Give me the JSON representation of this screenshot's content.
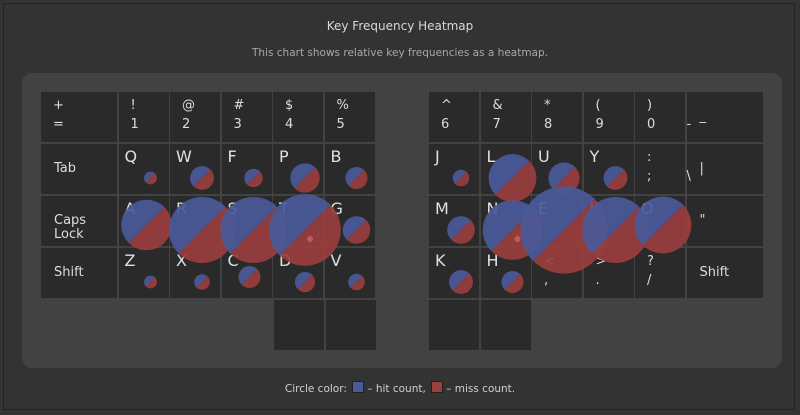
{
  "title": "Key Frequency Heatmap",
  "subtitle": "This chart shows relative key frequencies as a heatmap.",
  "legend": {
    "prefix": "Circle color:",
    "hit_label": "– hit count,",
    "miss_label": "– miss count.",
    "hit_color": "#4a5a9a",
    "miss_color": "#9a3e3e"
  },
  "left_rows": [
    [
      {
        "top": "+",
        "bot": "="
      },
      {
        "top": "!",
        "bot": "1"
      },
      {
        "top": "@",
        "bot": "2"
      },
      {
        "top": "#",
        "bot": "3"
      },
      {
        "top": "$",
        "bot": "4"
      },
      {
        "top": "%",
        "bot": "5"
      }
    ],
    [
      {
        "top": "Tab",
        "wide": true
      },
      {
        "top": "Q",
        "letter": true
      },
      {
        "top": "W",
        "letter": true
      },
      {
        "top": "F",
        "letter": true
      },
      {
        "top": "P",
        "letter": true
      },
      {
        "top": "B",
        "letter": true
      }
    ],
    [
      {
        "top": "Caps Lock",
        "wide": true
      },
      {
        "top": "A",
        "letter": true
      },
      {
        "top": "R",
        "letter": true
      },
      {
        "top": "S",
        "letter": true
      },
      {
        "top": "T",
        "letter": true
      },
      {
        "top": "G",
        "letter": true
      }
    ],
    [
      {
        "top": "Shift",
        "wide": true
      },
      {
        "top": "Z",
        "letter": true
      },
      {
        "top": "X",
        "letter": true
      },
      {
        "top": "C",
        "letter": true
      },
      {
        "top": "D",
        "letter": true
      },
      {
        "top": "V",
        "letter": true
      }
    ]
  ],
  "right_rows": [
    [
      {
        "top": "^",
        "bot": "6"
      },
      {
        "top": "&",
        "bot": "7"
      },
      {
        "top": "*",
        "bot": "8"
      },
      {
        "top": "(",
        "bot": "9"
      },
      {
        "top": ")",
        "bot": "0"
      },
      {
        "top": "_",
        "bot": "-",
        "wide": true
      }
    ],
    [
      {
        "top": "J",
        "letter": true
      },
      {
        "top": "L",
        "letter": true
      },
      {
        "top": "U",
        "letter": true
      },
      {
        "top": "Y",
        "letter": true
      },
      {
        "top": ":",
        "bot": ";"
      },
      {
        "top": "|",
        "bot": "\\",
        "wide": true
      }
    ],
    [
      {
        "top": "M",
        "letter": true
      },
      {
        "top": "N",
        "letter": true
      },
      {
        "top": "E",
        "letter": true
      },
      {
        "top": "I",
        "letter": true
      },
      {
        "top": "O",
        "letter": true
      },
      {
        "top": "\"",
        "bot": "'",
        "wide": true
      }
    ],
    [
      {
        "top": "K",
        "letter": true
      },
      {
        "top": "H",
        "letter": true
      },
      {
        "top": "<",
        "bot": ","
      },
      {
        "top": ">",
        "bot": "."
      },
      {
        "top": "?",
        "bot": "/"
      },
      {
        "top": "Shift",
        "wide": true
      }
    ]
  ],
  "thumb_keys": 4,
  "heat": {
    "Q": {
      "hit": 0.14,
      "miss": 0.14
    },
    "W": {
      "hit": 0.26,
      "miss": 0.26
    },
    "F": {
      "hit": 0.2,
      "miss": 0.2
    },
    "P": {
      "hit": 0.32,
      "miss": 0.32
    },
    "B": {
      "hit": 0.24,
      "miss": 0.24
    },
    "A": {
      "hit": 0.55,
      "miss": 0.55,
      "offset": true
    },
    "R": {
      "hit": 0.72,
      "miss": 0.72
    },
    "S": {
      "hit": 0.72,
      "miss": 0.72
    },
    "T": {
      "hit": 0.78,
      "miss": 0.78,
      "dot": true
    },
    "G": {
      "hit": 0.3,
      "miss": 0.3
    },
    "Z": {
      "hit": 0.14,
      "miss": 0.14
    },
    "X": {
      "hit": 0.17,
      "miss": 0.17
    },
    "C": {
      "hit": 0.24,
      "miss": 0.24,
      "offset": true
    },
    "D": {
      "hit": 0.22,
      "miss": 0.22
    },
    "V": {
      "hit": 0.18,
      "miss": 0.18
    },
    "J": {
      "hit": 0.18,
      "miss": 0.18
    },
    "L": {
      "hit": 0.52,
      "miss": 0.52
    },
    "U": {
      "hit": 0.34,
      "miss": 0.34
    },
    "Y": {
      "hit": 0.26,
      "miss": 0.26
    },
    "M": {
      "hit": 0.3,
      "miss": 0.3
    },
    "N": {
      "hit": 0.65,
      "miss": 0.65,
      "dot": true
    },
    "E": {
      "hit": 0.95,
      "miss": 0.95
    },
    "I": {
      "hit": 0.72,
      "miss": 0.72
    },
    "O": {
      "hit": 0.62,
      "miss": 0.62,
      "offset": true
    },
    "K": {
      "hit": 0.26,
      "miss": 0.26
    },
    "H": {
      "hit": 0.24,
      "miss": 0.24
    }
  }
}
